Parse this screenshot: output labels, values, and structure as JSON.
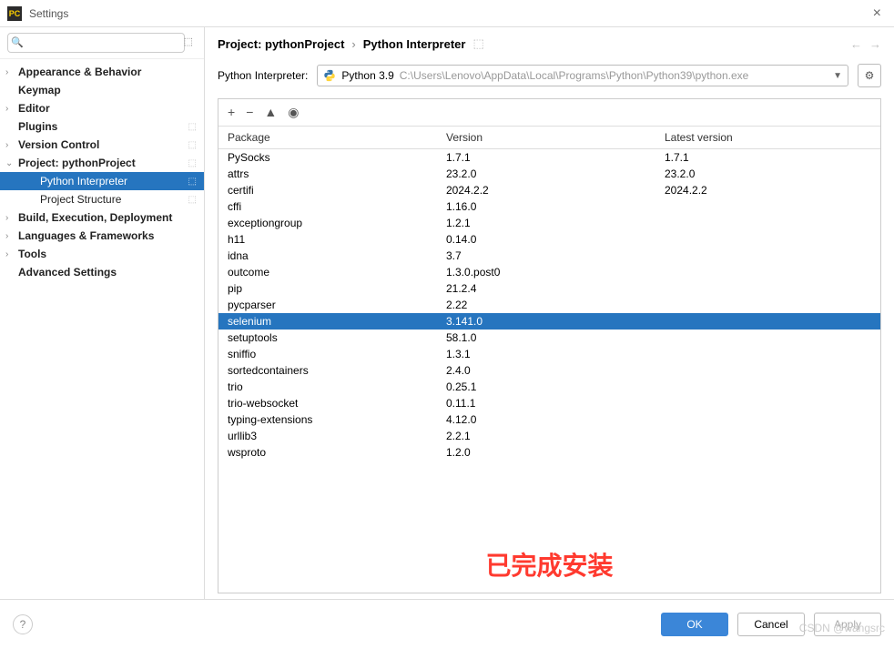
{
  "window": {
    "title": "Settings",
    "app_icon_text": "PC"
  },
  "sidebar": {
    "search_placeholder": "",
    "items": [
      {
        "label": "Appearance & Behavior",
        "expandable": true
      },
      {
        "label": "Keymap",
        "expandable": false
      },
      {
        "label": "Editor",
        "expandable": true
      },
      {
        "label": "Plugins",
        "expandable": false,
        "badge": true
      },
      {
        "label": "Version Control",
        "expandable": true,
        "badge": true
      },
      {
        "label": "Project: pythonProject",
        "expandable": true,
        "expanded": true,
        "badge": true,
        "children": [
          {
            "label": "Python Interpreter",
            "selected": true,
            "badge": true
          },
          {
            "label": "Project Structure",
            "badge": true
          }
        ]
      },
      {
        "label": "Build, Execution, Deployment",
        "expandable": true
      },
      {
        "label": "Languages & Frameworks",
        "expandable": true
      },
      {
        "label": "Tools",
        "expandable": true
      },
      {
        "label": "Advanced Settings",
        "expandable": false
      }
    ]
  },
  "breadcrumb": {
    "project": "Project: pythonProject",
    "page": "Python Interpreter"
  },
  "interpreter": {
    "label": "Python Interpreter:",
    "name": "Python 3.9",
    "path": "C:\\Users\\Lenovo\\AppData\\Local\\Programs\\Python\\Python39\\python.exe"
  },
  "packages": {
    "columns": {
      "pkg": "Package",
      "ver": "Version",
      "lat": "Latest version"
    },
    "rows": [
      {
        "pkg": "PySocks",
        "ver": "1.7.1",
        "lat": "1.7.1"
      },
      {
        "pkg": "attrs",
        "ver": "23.2.0",
        "lat": "23.2.0"
      },
      {
        "pkg": "certifi",
        "ver": "2024.2.2",
        "lat": "2024.2.2"
      },
      {
        "pkg": "cffi",
        "ver": "1.16.0",
        "lat": ""
      },
      {
        "pkg": "exceptiongroup",
        "ver": "1.2.1",
        "lat": ""
      },
      {
        "pkg": "h11",
        "ver": "0.14.0",
        "lat": ""
      },
      {
        "pkg": "idna",
        "ver": "3.7",
        "lat": ""
      },
      {
        "pkg": "outcome",
        "ver": "1.3.0.post0",
        "lat": ""
      },
      {
        "pkg": "pip",
        "ver": "21.2.4",
        "lat": ""
      },
      {
        "pkg": "pycparser",
        "ver": "2.22",
        "lat": ""
      },
      {
        "pkg": "selenium",
        "ver": "3.141.0",
        "lat": "",
        "selected": true
      },
      {
        "pkg": "setuptools",
        "ver": "58.1.0",
        "lat": ""
      },
      {
        "pkg": "sniffio",
        "ver": "1.3.1",
        "lat": ""
      },
      {
        "pkg": "sortedcontainers",
        "ver": "2.4.0",
        "lat": ""
      },
      {
        "pkg": "trio",
        "ver": "0.25.1",
        "lat": ""
      },
      {
        "pkg": "trio-websocket",
        "ver": "0.11.1",
        "lat": ""
      },
      {
        "pkg": "typing-extensions",
        "ver": "4.12.0",
        "lat": ""
      },
      {
        "pkg": "urllib3",
        "ver": "2.2.1",
        "lat": ""
      },
      {
        "pkg": "wsproto",
        "ver": "1.2.0",
        "lat": ""
      }
    ]
  },
  "overlay": {
    "text": "已完成安装"
  },
  "footer": {
    "ok": "OK",
    "cancel": "Cancel",
    "apply": "Apply"
  },
  "watermark": "CSDN @wangsrc"
}
